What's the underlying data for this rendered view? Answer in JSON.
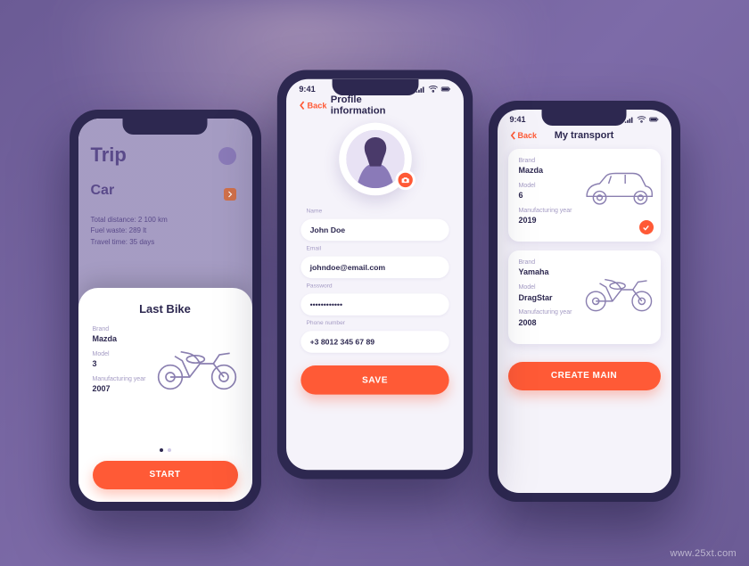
{
  "status": {
    "time": "9:41"
  },
  "colors": {
    "accent": "#ff5a36",
    "primary": "#2d2850"
  },
  "watermark": "www.25xt.com",
  "left": {
    "dimmed": {
      "title": "Trip",
      "subtitle": "Car",
      "stats": [
        "Total distance: 2 100 km",
        "Fuel waste: 289 lt",
        "Travel time: 35 days"
      ]
    },
    "sheet": {
      "title": "Last Bike",
      "labels": {
        "brand": "Brand",
        "model": "Model",
        "year": "Manufacturing year"
      },
      "values": {
        "brand": "Mazda",
        "model": "3",
        "year": "2007"
      },
      "cta": "START"
    }
  },
  "center": {
    "back": "Back",
    "title": "Profile information",
    "labels": {
      "name": "Name",
      "email": "Email",
      "password": "Password",
      "phone": "Phone number"
    },
    "values": {
      "name": "John Doe",
      "email": "johndoe@email.com",
      "password": "••••••••••••",
      "phone": "+3 8012 345 67 89"
    },
    "cta": "SAVE"
  },
  "right": {
    "back": "Back",
    "title": "My transport",
    "labels": {
      "brand": "Brand",
      "model": "Model",
      "year": "Manufacturing year"
    },
    "cards": [
      {
        "brand": "Mazda",
        "model": "6",
        "year": "2019",
        "selected": true,
        "type": "car"
      },
      {
        "brand": "Yamaha",
        "model": "DragStar",
        "year": "2008",
        "selected": false,
        "type": "bike"
      }
    ],
    "cta": "CREATE MAIN"
  }
}
